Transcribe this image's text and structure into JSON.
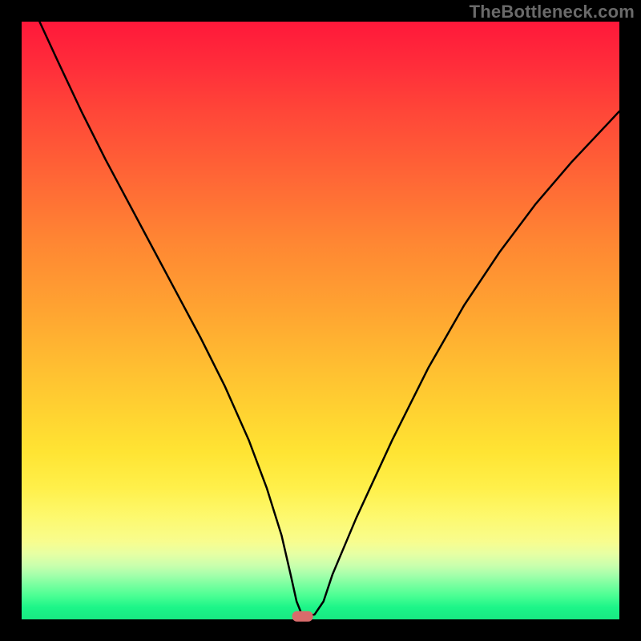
{
  "watermark": "TheBottleneck.com",
  "colors": {
    "gradient_top": "#ff183a",
    "gradient_mid": "#ffd431",
    "gradient_bottom": "#18e982",
    "background": "#000000",
    "curve_stroke": "#000000",
    "marker_fill": "#d86b6b"
  },
  "chart_data": {
    "type": "line",
    "title": "",
    "xlabel": "",
    "ylabel": "",
    "xlim": [
      0,
      100
    ],
    "ylim": [
      0,
      100
    ],
    "grid": false,
    "legend": false,
    "annotations": [
      "TheBottleneck.com"
    ],
    "marker": {
      "x": 47,
      "y": 0.5
    },
    "series": [
      {
        "name": "bottleneck-curve",
        "x": [
          3,
          6,
          10,
          14,
          18,
          22,
          26,
          30,
          34,
          38,
          41,
          43.5,
          45,
          46,
          47,
          49,
          50.5,
          52,
          56,
          62,
          68,
          74,
          80,
          86,
          92,
          100
        ],
        "y": [
          100,
          93.5,
          85,
          77,
          69.5,
          62,
          54.5,
          47,
          39,
          30,
          22,
          14,
          7.5,
          3,
          0.5,
          0.8,
          3,
          7.5,
          17,
          30,
          42,
          52.5,
          61.5,
          69.5,
          76.5,
          85
        ]
      }
    ]
  }
}
